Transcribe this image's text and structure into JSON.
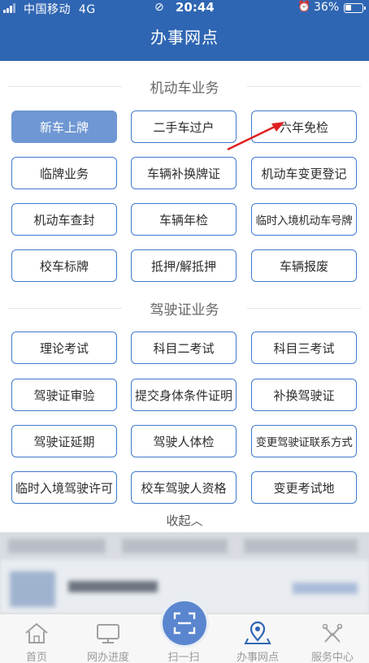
{
  "status_bar": {
    "carrier": "中国移动",
    "network": "4G",
    "time": "20:44",
    "battery": "36%",
    "battery_level": 0.36
  },
  "header": {
    "title": "办事网点"
  },
  "sections": [
    {
      "title": "机动车业务",
      "items": [
        "新车上牌",
        "二手车过户",
        "六年免检",
        "临牌业务",
        "车辆补换牌证",
        "机动车变更登记",
        "机动车查封",
        "车辆年检",
        "临时入境机动车号牌",
        "校车标牌",
        "抵押/解抵押",
        "车辆报废"
      ]
    },
    {
      "title": "驾驶证业务",
      "items": [
        "理论考试",
        "科目二考试",
        "科目三考试",
        "驾驶证审验",
        "提交身体条件证明",
        "补换驾驶证",
        "驾驶证延期",
        "驾驶人体检",
        "变更驾驶证联系方式",
        "临时入境驾驶许可",
        "校车驾驶人资格",
        "变更考试地"
      ]
    }
  ],
  "collapse_label": "收起︿",
  "tabbar": {
    "items": [
      {
        "label": "首页",
        "icon": "home-icon"
      },
      {
        "label": "网办进度",
        "icon": "monitor-icon"
      },
      {
        "label": "扫一扫",
        "icon": "scan-icon"
      },
      {
        "label": "办事网点",
        "icon": "map-pin-icon"
      },
      {
        "label": "服务中心",
        "icon": "service-icon"
      }
    ]
  },
  "colors": {
    "primary": "#2f66b3",
    "button_border": "#3f7bcc",
    "active_button": "#6f97d3",
    "annotation_arrow": "#e02020"
  }
}
